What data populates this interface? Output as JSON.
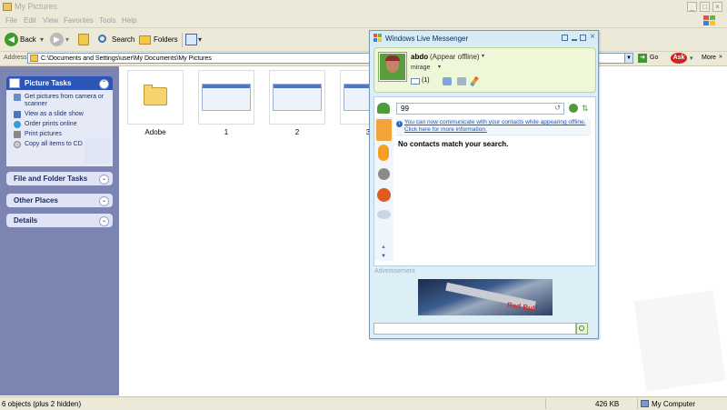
{
  "window": {
    "title": "My Pictures",
    "min": "_",
    "max": "□",
    "close": "×"
  },
  "menu": [
    "File",
    "Edit",
    "View",
    "Favorites",
    "Tools",
    "Help"
  ],
  "toolbar": {
    "back": "Back",
    "search": "Search",
    "folders": "Folders",
    "arrow": "▾"
  },
  "address": {
    "label": "Address",
    "path": "C:\\Documents and Settings\\user\\My Documents\\My Pictures",
    "go": "Go",
    "more": "More",
    "more_arrow": "»",
    "ask_logo": "Ask"
  },
  "taskpane": {
    "picture_tasks": {
      "title": "Picture Tasks",
      "items": [
        "Get pictures from camera or scanner",
        "View as a slide show",
        "Order prints online",
        "Print pictures",
        "Copy all items to CD"
      ]
    },
    "collapse": "⌃",
    "expand": "⌄",
    "sections": [
      "File and Folder Tasks",
      "Other Places",
      "Details"
    ]
  },
  "files": [
    {
      "name": "Adobe",
      "type": "folder"
    },
    {
      "name": "1",
      "type": "image"
    },
    {
      "name": "2",
      "type": "image"
    },
    {
      "name": "3",
      "type": "image"
    }
  ],
  "status": {
    "objects": "6 objects (plus 2 hidden)",
    "size": "426 KB",
    "location": "My Computer"
  },
  "messenger": {
    "title": "Windows Live Messenger",
    "user": "abdo",
    "status": "(Appear offline)",
    "personal_message": "mirage",
    "mail_count": "(1)",
    "search_value": "99",
    "info_link": "You can now communicate with your contacts while appearing offline. Click here for more information.",
    "no_results": "No contacts match your search.",
    "ad_label": "Advertisement",
    "ad_text": "Red Bull"
  },
  "colors": {
    "taskpane": "#7c84b2",
    "msn_border": "#7a96b6",
    "link": "#1d58c4"
  }
}
